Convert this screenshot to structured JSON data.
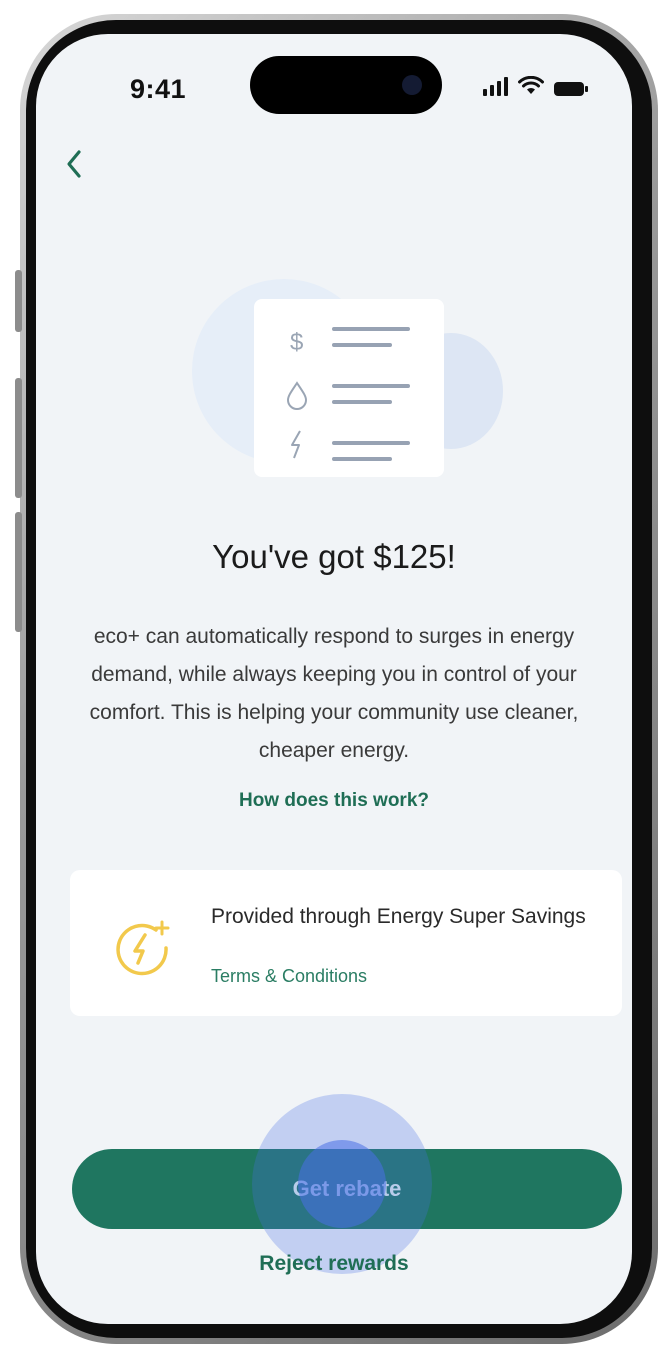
{
  "status_bar": {
    "time": "9:41",
    "icons": [
      "signal-icon",
      "wifi-icon",
      "battery-icon"
    ]
  },
  "nav": {
    "back_icon": "chevron-left-icon"
  },
  "illustration": {
    "icons": [
      "dollar-icon",
      "water-drop-icon",
      "lightning-icon"
    ]
  },
  "main": {
    "title": "You've got $125!",
    "description": "eco+ can automatically respond to surges in energy demand, while always keeping you in control of your comfort. This is helping your community use cleaner, cheaper energy.",
    "how_link": "How does this work?"
  },
  "provider_card": {
    "icon": "energy-savings-icon",
    "text": "Provided through Energy Super Savings",
    "terms_link": "Terms & Conditions"
  },
  "actions": {
    "primary_label": "Get rebate",
    "secondary_label": "Reject rewards"
  },
  "colors": {
    "accent": "#1f7660",
    "link": "#1f6e55",
    "icon_yellow": "#f2c94c",
    "background": "#f1f4f7",
    "touch_indicator": "#4870e6"
  }
}
